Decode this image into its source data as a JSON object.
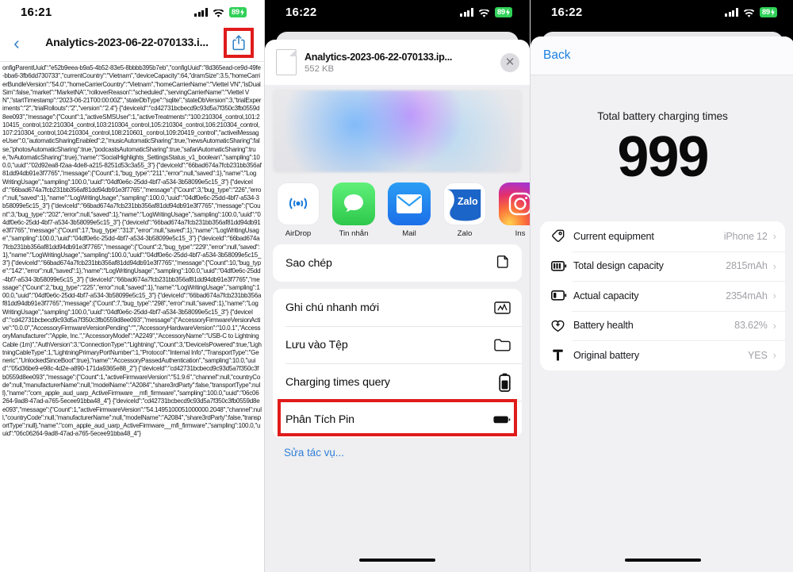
{
  "panel1": {
    "status": {
      "time": "16:21",
      "battery": "89"
    },
    "nav": {
      "back_icon": "chevron-left-icon",
      "title": "Analytics-2023-06-22-070133.i...",
      "share_icon": "share-icon"
    },
    "log_text": "onfigParentUuid\":\"e52b9eea-b9a5-4b52-83e5-8bbbb395b7eb\",\"configUuid\":\"8d365ead-ce9d-49fe-bba6-3fb6dd730733\",\"currentCountry\":\"Vietnam\",\"deviceCapacity\":64,\"dramSize\":3.5,\"homeCarrierBundleVersion\":\"54.0\",\"homeCarrierCountry\":\"Vietnam\",\"homeCarrierName\":\"Viettel VN\",\"isDualSim\":false,\"market\":\"MarketNA\",\"rolloverReason\":\"scheduled\",\"servingCarrierName\":\"Viettel VN\",\"startTimestamp\":\"2023-06-21T00:00:00Z\",\"stateDbType\":\"sqlite\",\"stateDbVersion\":3,\"trialExperiments\":\"2\",\"trialRollouts\":\"2\",\"version\":\"2.4\"}\n{\"deviceId\":\"cd42731bcbecd9c93d5a7f350c3fb0559d8ee093\",\"message\":{\"Count\":1,\"activeSMSUser\":1,\"activeTreatments\":\"100:210304_control,101:210415_control,102:210304_control,103:210304_control,105:210304_control,106:210304_control,107:210304_control,104:210304_control,108:210601_control,109:20419_control\",\"activeiMessageUser\":0,\"automaticSharingEnabled\":2,\"musicAutomaticSharing\":true,\"newsAutomaticSharing\":false,\"photosAutomaticSharing\":true,\"podcastsAutomaticSharing\":true,\"safariAutomaticSharing\":true,\"tvAutomaticSharing\":true},\"name\":\"SocialHighlights_SettingsStatus_v1_boolean\",\"sampling\":100.0,\"uuid\":\"02d92ea8-f2aa-4de8-a215-8251d53c3a55_3\"}\n{\"deviceId\":\"66bad674a7fcb231bb356af81dd94db91e3f7765\",\"message\":{\"Count\":1,\"bug_type\":\"211\",\"error\":null,\"saved\":1},\"name\":\"LogWritingUsage\",\"sampling\":100.0,\"uuid\":\"04df0e6c-25dd-4bf7-a534-3b58099e5c15_3\"}\n{\"deviceId\":\"66bad674a7fcb231bb356af81dd94db91e3f7765\",\"message\":{\"Count\":3,\"bug_type\":\"226\",\"error\":null,\"saved\":1},\"name\":\"LogWritingUsage\",\"sampling\":100.0,\"uuid\":\"04df0e6c-25dd-4bf7-a534-3b58099e5c15_3\"}\n{\"deviceId\":\"66bad674a7fcb231bb356af81dd94db91e3f7765\",\"message\":{\"Count\":3,\"bug_type\":\"202\",\"error\":null,\"saved\":1},\"name\":\"LogWritingUsage\",\"sampling\":100.0,\"uuid\":\"04df0e6c-25dd-4bf7-a534-3b58099e5c15_3\"}\n{\"deviceId\":\"66bad674a7fcb231bb356af81dd94db91e3f7765\",\"message\":{\"Count\":17,\"bug_type\":\"313\",\"error\":null,\"saved\":1},\"name\":\"LogWritingUsage\",\"sampling\":100.0,\"uuid\":\"04df0e6c-25dd-4bf7-a534-3b58099e5c15_3\"}\n{\"deviceId\":\"66bad674a7fcb231bb356af81dd94db91e3f7765\",\"message\":{\"Count\":2,\"bug_type\":\"229\",\"error\":null,\"saved\":1},\"name\":\"LogWritingUsage\",\"sampling\":100.0,\"uuid\":\"04df0e6c-25dd-4bf7-a534-3b58099e5c15_3\"}\n{\"deviceId\":\"66bad674a7fcb231bb356af81dd94db91e3f7765\",\"message\":{\"Count\":10,\"bug_type\":\"142\",\"error\":null,\"saved\":1},\"name\":\"LogWritingUsage\",\"sampling\":100.0,\"uuid\":\"04df0e6c-25dd-4bf7-a534-3b58099e5c15_3\"}\n{\"deviceId\":\"66bad674a7fcb231bb356af81dd94db91e3f7765\",\"message\":{\"Count\":2,\"bug_type\":\"225\",\"error\":null,\"saved\":1},\"name\":\"LogWritingUsage\",\"sampling\":100.0,\"uuid\":\"04df0e6c-25dd-4bf7-a534-3b58099e5c15_3\"}\n{\"deviceId\":\"66bad674a7fcb231bb356af81dd94db91e3f7765\",\"message\":{\"Count\":7,\"bug_type\":\"298\",\"error\":null,\"saved\":1},\"name\":\"LogWritingUsage\",\"sampling\":100.0,\"uuid\":\"04df0e6c-25dd-4bf7-a534-3b58099e5c15_3\"}\n{\"deviceId\":\"cd42731bcbecd9c93d5a7f350c3fb0559d8ee093\",\"message\":{\"AccessoryFirmwareVersionActive\":\"0.0.0\",\"AccessoryFirmwareVersionPending\":\"\",\"AccessoryHardwareVersion\":\"10.0.1\",\"AccessoryManufacturer\":\"Apple, Inc.\",\"AccessoryModel\":\"A2249\",\"AccessoryName\":\"USB-C to Lightning Cable (1m)\",\"AuthVersion\":3,\"ConnectionType\":\"Lightning\",\"Count\":3,\"DeviceIsPowered\":true,\"LightningCableType\":1,\"LightningPrimaryPortNumber\":1,\"Protocol\":\"Internal Info\",\"TransportType\":\"Generic\",\"UnlockedSinceBoot\":true},\"name\":\"AccessoryPassedAuthentication\",\"sampling\":10.0,\"uuid\":\"05d36be9-e98c-4d2e-a890-171da9365e88_2\"}\n{\"deviceId\":\"cd42731bcbecd9c93d5a7f350c3fb0559d8ee093\",\"message\":{\"Count\":1,\"activeFirmwareVersion\":\"51.9.6\",\"channel\":null,\"countryCode\":null,\"manufacturerName\":null,\"modelName\":\"A2084\",\"share3rdParty\":false,\"transportType\":null},\"name\":\"com_apple_aud_uarp_ActiveFirmware__mfi_firmware\",\"sampling\":100.0,\"uuid\":\"06c06264-9ad8-47ad-a765-5ecee91bba48_4\"}\n{\"deviceId\":\"cd42731bcbecd9c93d5a7f350c3fb0559d8ee093\",\"message\":{\"Count\":1,\"activeFirmwareVersion\":\"54.1495100051000000.2048\",\"channel\":null,\"countryCode\":null,\"manufacturerName\":null,\"modelName\":\"A2084\",\"share3rdParty\":false,\"transportType\":null},\"name\":\"com_apple_aud_uarp_ActiveFirmware__mfi_firmware\",\"sampling\":100.0,\"uuid\":\"06c06264-9ad8-47ad-a765-5ecee91bba48_4\"}"
  },
  "panel2": {
    "status": {
      "time": "16:22",
      "battery": "89"
    },
    "file": {
      "name": "Analytics-2023-06-22-070133.ip...",
      "size": "552 KB",
      "icon": "document-icon",
      "close_icon": "close-icon"
    },
    "preview_name": "file-preview-gradient",
    "apps": [
      {
        "label": "AirDrop",
        "icon": "airdrop-icon"
      },
      {
        "label": "Tin nhắn",
        "icon": "messages-icon"
      },
      {
        "label": "Mail",
        "icon": "mail-icon"
      },
      {
        "label": "Zalo",
        "icon": "zalo-icon"
      },
      {
        "label": "Ins",
        "icon": "instagram-icon"
      }
    ],
    "actions_group1": [
      {
        "label": "Sao chép",
        "icon": "copy-icon"
      }
    ],
    "actions_group2": [
      {
        "label": "Ghi chú nhanh mới",
        "icon": "quick-note-icon"
      },
      {
        "label": "Lưu vào Tệp",
        "icon": "folder-icon"
      },
      {
        "label": "Charging times query",
        "icon": "battery-vertical-icon",
        "highlighted": true
      },
      {
        "label": "Phân Tích Pin",
        "icon": "battery-horizontal-icon"
      }
    ],
    "edit_actions_label": "Sửa tác vụ..."
  },
  "panel3": {
    "status": {
      "time": "16:22",
      "battery": "89"
    },
    "nav": {
      "back_label": "Back"
    },
    "headline": {
      "title": "Total battery charging times",
      "value": "999"
    },
    "rows": [
      {
        "icon": "tag-icon",
        "label": "Current equipment",
        "value": "iPhone 12"
      },
      {
        "icon": "battery-full-icon",
        "label": "Total design capacity",
        "value": "2815mAh"
      },
      {
        "icon": "battery-low-icon",
        "label": "Actual capacity",
        "value": "2354mAh"
      },
      {
        "icon": "heart-plus-icon",
        "label": "Battery health",
        "value": "83.62%"
      },
      {
        "icon": "hammer-icon",
        "label": "Original battery",
        "value": "YES"
      }
    ],
    "chevron": "›"
  },
  "colors": {
    "accent_blue": "#1b7fe0",
    "highlight_red": "#e01b1b",
    "battery_green": "#30d158"
  }
}
